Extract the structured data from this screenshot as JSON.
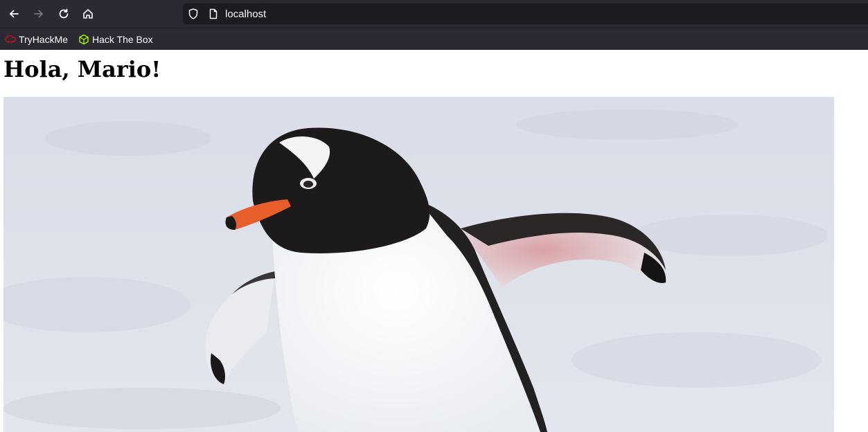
{
  "browser": {
    "url": "localhost",
    "nav": {
      "back": "back-icon",
      "forward": "forward-icon",
      "reload": "reload-icon",
      "home": "home-icon"
    }
  },
  "bookmarks": [
    {
      "label": "TryHackMe",
      "icon": "tryhackme-icon"
    },
    {
      "label": "Hack The Box",
      "icon": "hackthebox-icon"
    }
  ],
  "page": {
    "heading": "Hola, Mario!",
    "image": {
      "subject": "gentoo penguin on snow"
    }
  },
  "colors": {
    "toolbar": "#2b2a33",
    "urlbar": "#1c1b22",
    "text": "#fbfbfe",
    "tryhackme": "#c11111",
    "hackthebox": "#9fef00"
  }
}
